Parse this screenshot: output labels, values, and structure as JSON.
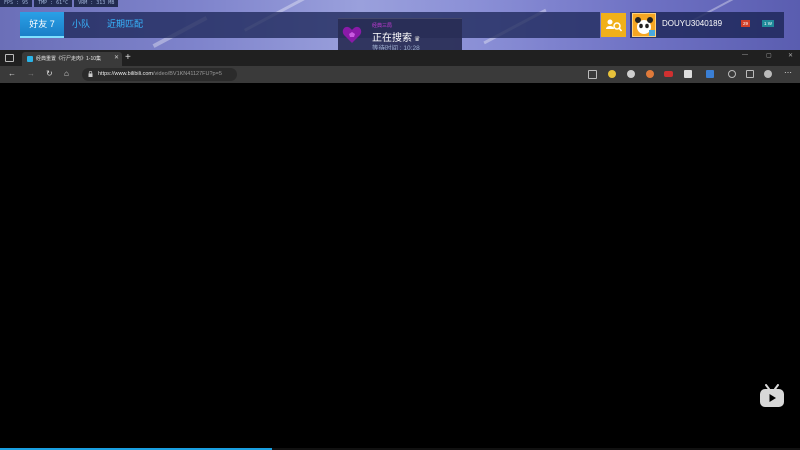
{
  "stats": [
    {
      "label": "FPS : 95"
    },
    {
      "label": "TMP : 61°C"
    },
    {
      "label": "VRM : 313 MB"
    }
  ],
  "game_nav": {
    "tabs": [
      {
        "label": "好友 7",
        "active": true
      },
      {
        "label": "小队",
        "active": false
      },
      {
        "label": "近期匹配",
        "active": false
      }
    ]
  },
  "search_status": {
    "mode": "经典三局",
    "title": "正在搜索",
    "wait": "等待时间 : 10:28"
  },
  "profile": {
    "username": "DOUYU3040189",
    "badge_1": "29",
    "badge_2": "1 W"
  },
  "browser": {
    "tab_title": "经典重置《行尸走肉》1-10集 ",
    "url_host": "https://www.bilibili.com",
    "url_path": "/video/BV1KN41127FU?p=5",
    "window_controls": [
      "—",
      "▢",
      "✕"
    ]
  },
  "video": {
    "progress": 0.34
  },
  "colors": {
    "accent": "#37b6ff",
    "search_mode": "#c43bd6",
    "quick_button": "#f0b019"
  }
}
